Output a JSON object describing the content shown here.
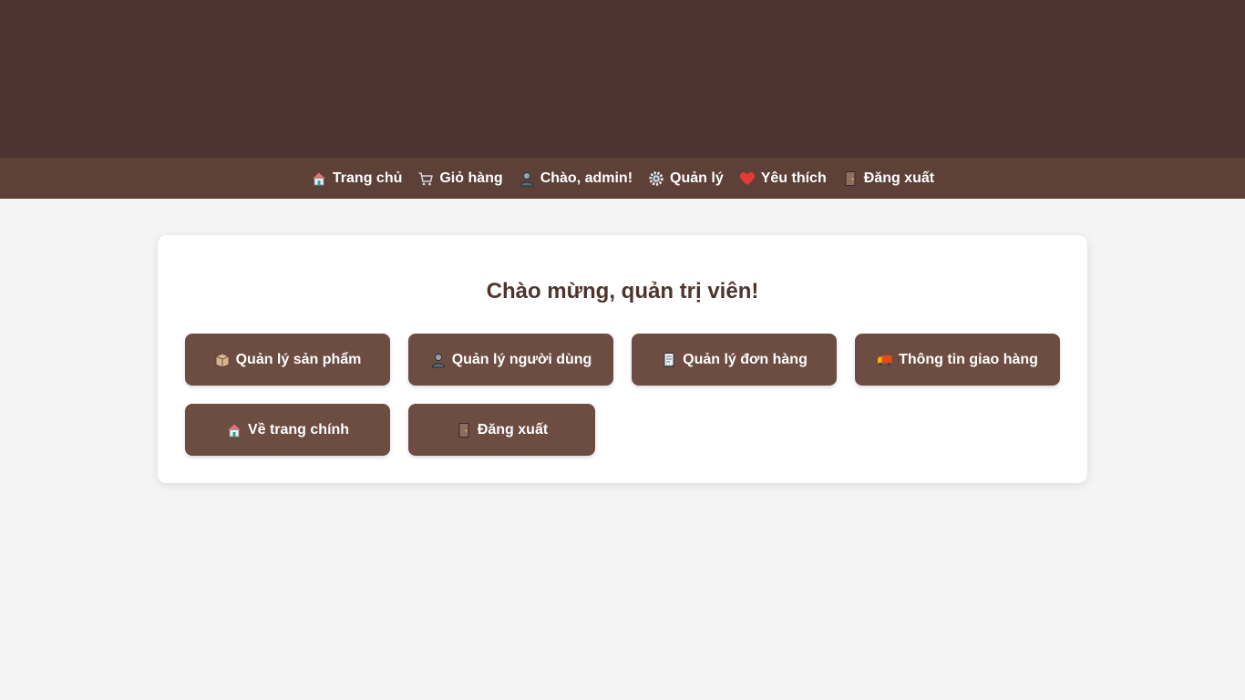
{
  "nav": {
    "home": "Trang chủ",
    "cart": "Giỏ hàng",
    "greeting": "Chào, admin!",
    "manage": "Quản lý",
    "favorites": "Yêu thích",
    "logout": "Đăng xuất"
  },
  "admin": {
    "title": "Chào mừng, quản trị viên!",
    "products_label": "Quản lý sản phẩm",
    "users_label": "Quản lý người dùng",
    "orders_label": "Quản lý đơn hàng",
    "shipping_label": "Thông tin giao hàng",
    "back_home_label": "Về trang chính",
    "logout_label": "Đăng xuất"
  },
  "icons": {
    "home": "house-icon",
    "cart": "cart-icon",
    "user": "user-icon",
    "manage": "gear-icon",
    "favorites": "heart-icon",
    "logout": "door-icon",
    "products": "box-icon",
    "orders": "receipt-icon",
    "shipping": "truck-icon"
  },
  "colors": {
    "banner": "#4e3430",
    "navbar": "#5d4037",
    "button": "#6d4c41",
    "title": "#4e342e",
    "page_bg": "#f4f4f4",
    "heart": "#e53935"
  }
}
